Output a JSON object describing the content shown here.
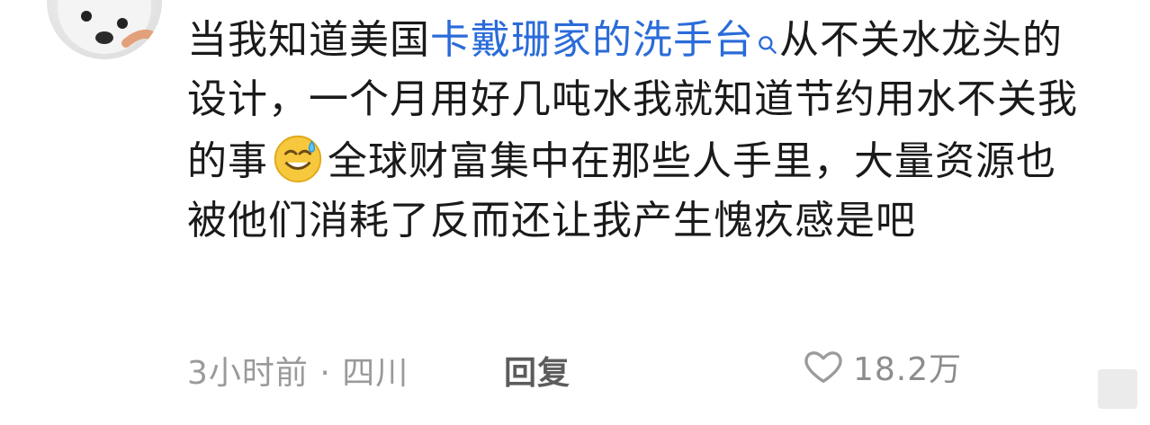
{
  "comment": {
    "text_before_link": "当我知道美国",
    "link_text": "卡戴珊家的洗手台",
    "text_after_link_1": "从不关水龙头的设计，一个月用好几吨水我就知道节约用水不关我的事",
    "text_after_emoji": "全球财富集中在那些人手里，大量资源也被他们消耗了反而还让我产生愧疚感是吧"
  },
  "footer": {
    "meta": "3小时前 · 四川",
    "reply_label": "回复",
    "like_count": "18.2万"
  },
  "icons": {
    "search": "search-icon",
    "emoji": "sweat-smile-emoji-icon",
    "like": "heart-outline-icon"
  },
  "colors": {
    "link": "#2a6bd9",
    "meta": "#9a9a9a",
    "reply": "#5c5c5c",
    "like_count": "#8d8d8d"
  }
}
